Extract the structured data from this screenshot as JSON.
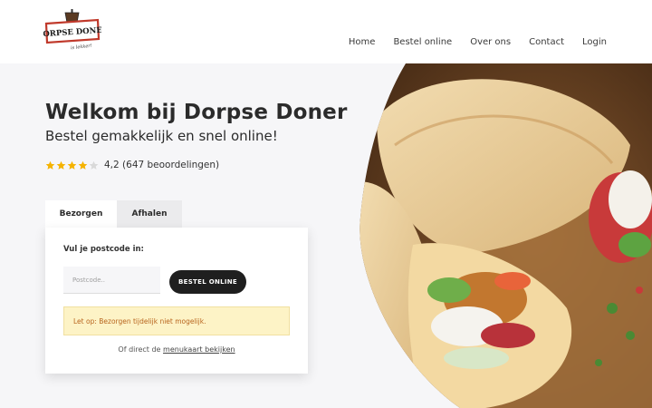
{
  "header": {
    "logo_text": "DORPSE DONER",
    "logo_tagline": "is lekker!",
    "nav": [
      "Home",
      "Bestel online",
      "Over ons",
      "Contact",
      "Login"
    ]
  },
  "hero": {
    "title": "Welkom bij Dorpse Doner",
    "subtitle": "Bestel gemakkelijk en snel online!",
    "rating": {
      "stars_filled": 4,
      "stars_total": 5,
      "text": "4,2 (647 beoordelingen)"
    }
  },
  "order": {
    "tabs": [
      "Bezorgen",
      "Afhalen"
    ],
    "active_tab": "Bezorgen",
    "postcode_label": "Vul je postcode in:",
    "postcode_value": "",
    "postcode_placeholder": "Postcode..",
    "button_label": "BESTEL ONLINE",
    "notice": "Let op: Bezorgen tijdelijk niet mogelijk.",
    "menu_prefix": "Of direct de ",
    "menu_link": "menukaart bekijken"
  },
  "colors": {
    "star_active": "#f5b301",
    "star_inactive": "#d9d9d9",
    "button_bg": "#1f1f1f",
    "notice_bg": "#fdf3c6",
    "notice_text": "#b8651e",
    "logo_red": "#c0392b"
  }
}
